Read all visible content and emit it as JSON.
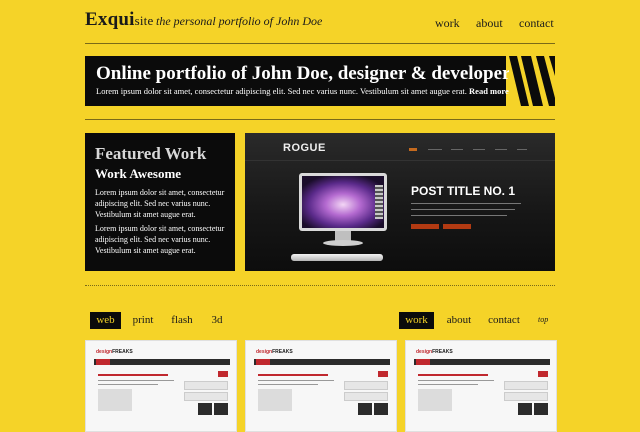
{
  "header": {
    "logo_main": "Exqui",
    "logo_site": "site",
    "tagline": "the personal portfolio of John Doe",
    "nav": [
      "work",
      "about",
      "contact"
    ]
  },
  "banner": {
    "title": "Online portfolio of John Doe, designer & developer",
    "subtitle": "Lorem ipsum dolor sit amet, consectetur adipiscing elit. Sed nec varius nunc. Vestibulum sit amet augue erat.",
    "read_more": "Read more ..."
  },
  "featured": {
    "heading": "Featured Work",
    "subheading": "Work Awesome",
    "paragraphs": [
      "Lorem ipsum dolor sit amet, consectetur adipiscing elit. Sed nec varius nunc. Vestibulum sit amet augue erat.",
      "Lorem ipsum dolor sit amet, consectetur adipiscing elit. Sed nec varius nunc. Vestibulum sit amet augue erat."
    ]
  },
  "showcase": {
    "brand": "ROGUE",
    "post_title": "POST TITLE NO. 1"
  },
  "filters": {
    "left": [
      "web",
      "print",
      "flash",
      "3d"
    ],
    "right": [
      "work",
      "about",
      "contact"
    ],
    "top_link": "top"
  },
  "thumbnails": {
    "logo_a": "design",
    "logo_b": "FREAKS"
  },
  "colors": {
    "background": "#f5d328",
    "dark": "#0b0b0b",
    "accent_red": "#c0282e"
  }
}
